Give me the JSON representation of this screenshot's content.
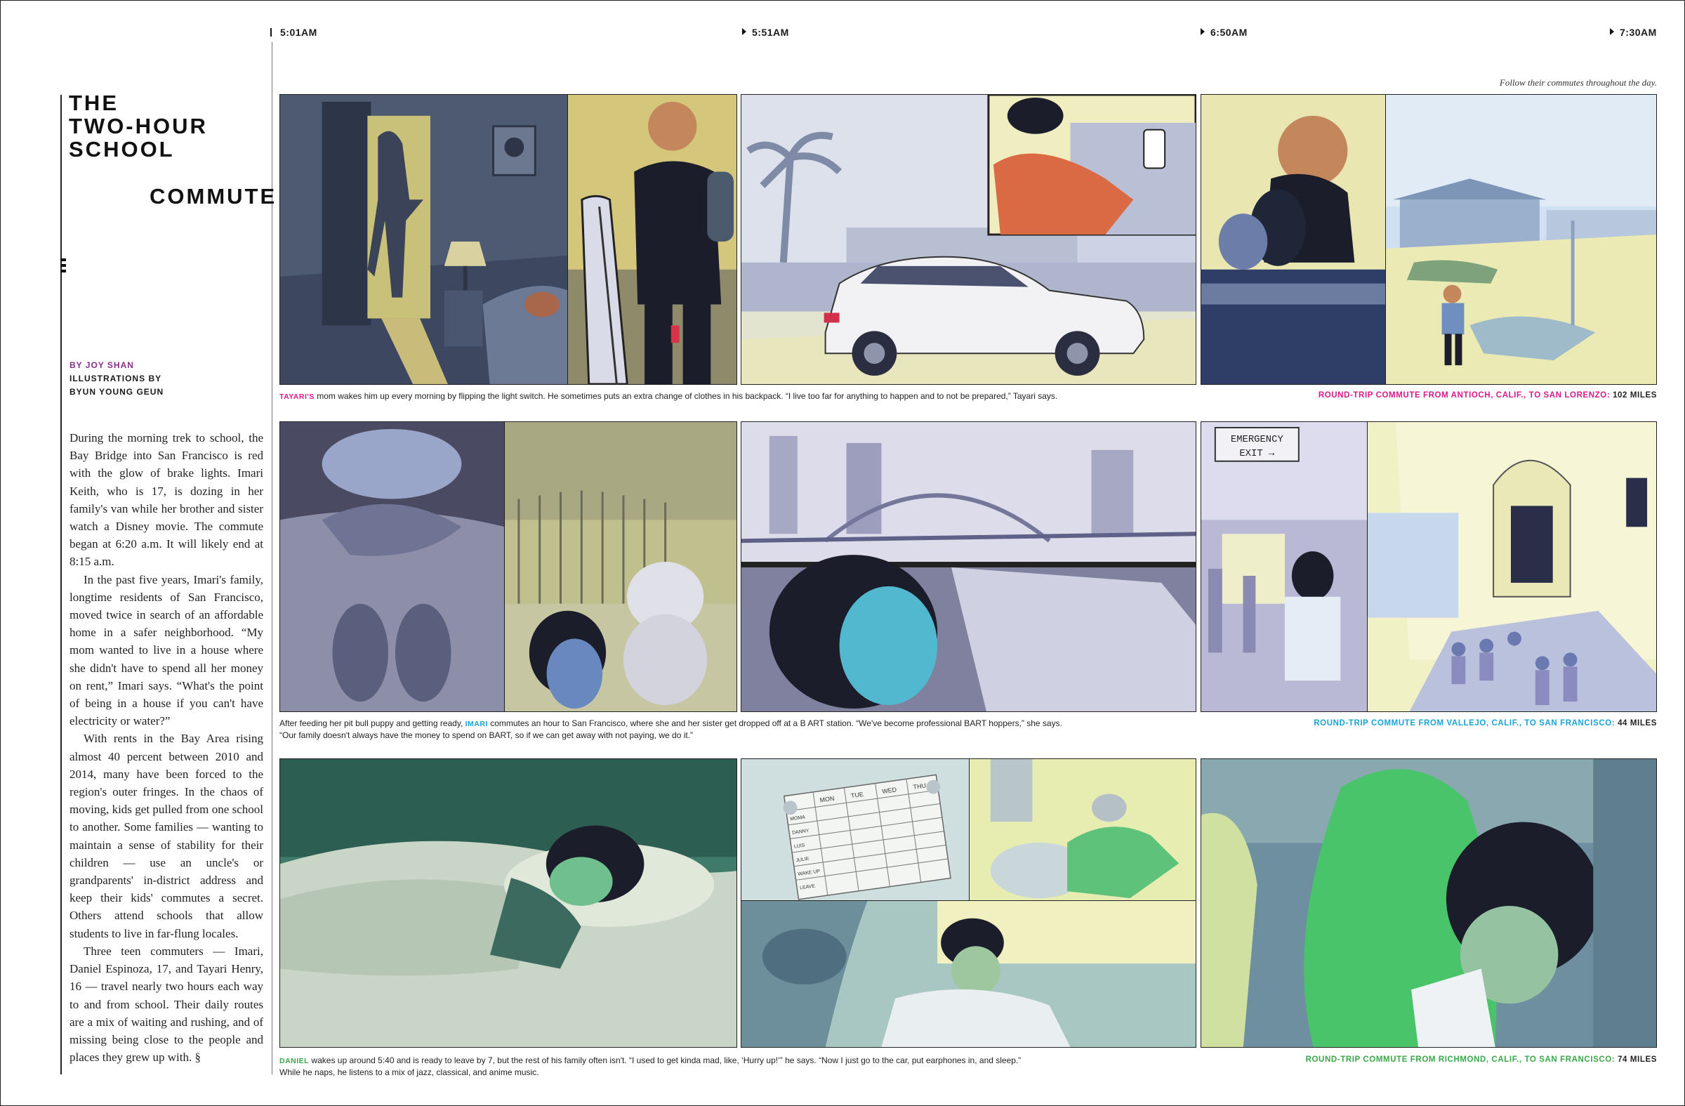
{
  "timeline": {
    "times": [
      "5:01AM",
      "5:51AM",
      "6:50AM",
      "7:30AM"
    ]
  },
  "article": {
    "title_lines": [
      "THE",
      "TWO-HOUR",
      "SCHOOL"
    ],
    "title_last": "COMMUTE",
    "byline_author": "BY JOY SHAN",
    "byline_illus_1": "ILLUSTRATIONS BY",
    "byline_illus_2": "BYUN YOUNG GEUN",
    "paragraphs": [
      "During the morning trek to school, the Bay Bridge into San Francisco is red with the glow of brake lights. Imari Keith, who is 17, is dozing in her family's van while her brother and sister watch a Disney movie. The commute began at 6:20 a.m. It will likely end at 8:15 a.m.",
      "In the past five years, Imari's family, longtime residents of San Francisco, moved twice in search of an affordable home in a safer neighborhood. “My mom wanted to live in a house where she didn't have to spend all her money on rent,” Imari says. “What's the point of being in a house if you can't have electricity or water?”",
      "With rents in the Bay Area rising almost 40 percent between 2010 and 2014, many have been forced to the region's outer fringes. In the chaos of moving, kids get pulled from one school to another. Some families — wanting to maintain a sense of stability for their children — use an uncle's or grandparents' in-district address and keep their kids' commutes a secret. Others attend schools that allow students to live in far-flung locales.",
      "Three teen commuters — Imari, Daniel Espinoza, 17, and Tayari Henry, 16 — travel nearly two hours each way to and from school. Their daily routes are a mix of waiting and rushing, and of missing being close to the people and places they grew up with. §"
    ]
  },
  "note": "Follow their commutes throughout the day.",
  "rows": [
    {
      "name": "TAYARI'S",
      "caption": " mom wakes him up every morning by flipping the light switch. He sometimes puts an extra change of clothes in his backpack. “I   live too far for anything to happen and to not be prepared,” Tayari says.",
      "caption_2": "",
      "commute": "ROUND-TRIP COMMUTE FROM ANTIOCH, CALIF., TO SAN LORENZO:",
      "miles": "102 MILES",
      "color": "#d81b8c"
    },
    {
      "name": "IMARI",
      "caption_pre": "After feeding her pit bull puppy and getting ready, ",
      "caption": " commutes an hour to San Francisco, where she and her sister get dropped off at a B  ART station. “We've become professional BART hoppers,” she says.",
      "caption_2": "“Our family doesn't always have the money to spend on BART, so if we can get away with not paying, we do it.”",
      "commute": "ROUND-TRIP COMMUTE FROM VALLEJO, CALIF., TO SAN FRANCISCO:",
      "miles": "44 MILES",
      "color": "#1aa3d6"
    },
    {
      "name": "DANIEL",
      "caption": " wakes up around 5:40 and is ready to leave by 7, but the rest of his family often isn't. “I used to get kinda mad, like, ‘Hurry up!’” he says.  “Now I just go to the car, put earphones in, and sleep.”",
      "caption_2": "While he naps, he listens to a mix of jazz, classical, and anime music.",
      "commute": "ROUND-TRIP COMMUTE FROM RICHMOND, CALIF., TO SAN FRANCISCO:",
      "miles": "74 MILES",
      "color": "#3aa84a"
    }
  ],
  "illustration_text": {
    "emergency_1": "EMERGENCY",
    "emergency_2": "EXIT →",
    "schedule_days": [
      "MON",
      "TUE",
      "WED",
      "THU"
    ],
    "schedule_rows": [
      "MOMA",
      "DANNY",
      "LUIS",
      "JULIE",
      "WAKE UP",
      "LEAVE"
    ]
  }
}
